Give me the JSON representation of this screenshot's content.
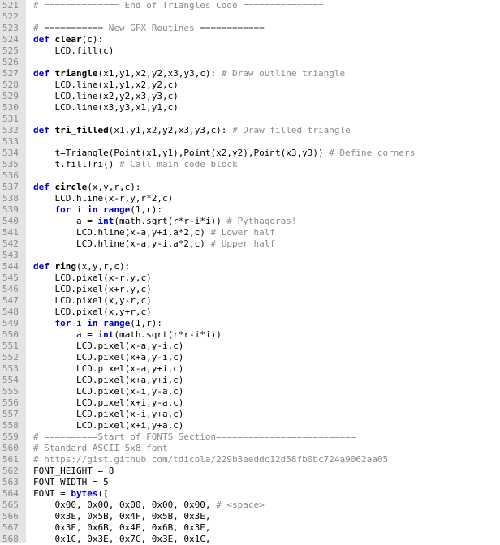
{
  "editor": {
    "lines": [
      {
        "n": "521",
        "t": [
          {
            "c": "cm",
            "s": "# ============== End of Triangles Code ==============="
          }
        ]
      },
      {
        "n": "522",
        "t": []
      },
      {
        "n": "523",
        "t": [
          {
            "c": "cm",
            "s": "# =========== New GFX Routines ============"
          }
        ]
      },
      {
        "n": "524",
        "t": [
          {
            "c": "kw",
            "s": "def "
          },
          {
            "c": "fn",
            "s": "clear"
          },
          {
            "c": "tx",
            "s": "(c):"
          }
        ]
      },
      {
        "n": "525",
        "t": [
          {
            "c": "tx",
            "s": "    LCD.fill(c)"
          }
        ]
      },
      {
        "n": "526",
        "t": []
      },
      {
        "n": "527",
        "t": [
          {
            "c": "kw",
            "s": "def "
          },
          {
            "c": "fn",
            "s": "triangle"
          },
          {
            "c": "tx",
            "s": "(x1,y1,x2,y2,x3,y3,c): "
          },
          {
            "c": "cm",
            "s": "# Draw outline triangle"
          }
        ]
      },
      {
        "n": "528",
        "t": [
          {
            "c": "tx",
            "s": "    LCD.line(x1,y1,x2,y2,c)"
          }
        ]
      },
      {
        "n": "529",
        "t": [
          {
            "c": "tx",
            "s": "    LCD.line(x2,y2,x3,y3,c)"
          }
        ]
      },
      {
        "n": "530",
        "t": [
          {
            "c": "tx",
            "s": "    LCD.line(x3,y3,x1,y1,c)"
          }
        ]
      },
      {
        "n": "531",
        "t": []
      },
      {
        "n": "532",
        "t": [
          {
            "c": "kw",
            "s": "def "
          },
          {
            "c": "fn",
            "s": "tri_filled"
          },
          {
            "c": "tx",
            "s": "(x1,y1,x2,y2,x3,y3,c): "
          },
          {
            "c": "cm",
            "s": "# Draw filled triangle"
          }
        ]
      },
      {
        "n": "533",
        "t": []
      },
      {
        "n": "534",
        "t": [
          {
            "c": "tx",
            "s": "    t=Triangle(Point(x1,y1),Point(x2,y2),Point(x3,y3)) "
          },
          {
            "c": "cm",
            "s": "# Define corners"
          }
        ]
      },
      {
        "n": "535",
        "t": [
          {
            "c": "tx",
            "s": "    t.fillTri() "
          },
          {
            "c": "cm",
            "s": "# Call main code block"
          }
        ]
      },
      {
        "n": "536",
        "t": []
      },
      {
        "n": "537",
        "t": [
          {
            "c": "kw",
            "s": "def "
          },
          {
            "c": "fn",
            "s": "circle"
          },
          {
            "c": "tx",
            "s": "(x,y,r,c):"
          }
        ]
      },
      {
        "n": "538",
        "t": [
          {
            "c": "tx",
            "s": "    LCD.hline(x-r,y,r*2,c)"
          }
        ]
      },
      {
        "n": "539",
        "t": [
          {
            "c": "tx",
            "s": "    "
          },
          {
            "c": "kw",
            "s": "for"
          },
          {
            "c": "tx",
            "s": " i "
          },
          {
            "c": "kw",
            "s": "in"
          },
          {
            "c": "tx",
            "s": " "
          },
          {
            "c": "kw",
            "s": "range"
          },
          {
            "c": "tx",
            "s": "(1,r):"
          }
        ]
      },
      {
        "n": "540",
        "t": [
          {
            "c": "tx",
            "s": "        a = "
          },
          {
            "c": "kw",
            "s": "int"
          },
          {
            "c": "tx",
            "s": "(math.sqrt(r*r-i*i)) "
          },
          {
            "c": "cm",
            "s": "# Pythagoras!"
          }
        ]
      },
      {
        "n": "541",
        "t": [
          {
            "c": "tx",
            "s": "        LCD.hline(x-a,y+i,a*2,c) "
          },
          {
            "c": "cm",
            "s": "# Lower half"
          }
        ]
      },
      {
        "n": "542",
        "t": [
          {
            "c": "tx",
            "s": "        LCD.hline(x-a,y-i,a*2,c) "
          },
          {
            "c": "cm",
            "s": "# Upper half"
          }
        ]
      },
      {
        "n": "543",
        "t": []
      },
      {
        "n": "544",
        "t": [
          {
            "c": "kw",
            "s": "def "
          },
          {
            "c": "fn",
            "s": "ring"
          },
          {
            "c": "tx",
            "s": "(x,y,r,c):"
          }
        ]
      },
      {
        "n": "545",
        "t": [
          {
            "c": "tx",
            "s": "    LCD.pixel(x-r,y,c)"
          }
        ]
      },
      {
        "n": "546",
        "t": [
          {
            "c": "tx",
            "s": "    LCD.pixel(x+r,y,c)"
          }
        ]
      },
      {
        "n": "547",
        "t": [
          {
            "c": "tx",
            "s": "    LCD.pixel(x,y-r,c)"
          }
        ]
      },
      {
        "n": "548",
        "t": [
          {
            "c": "tx",
            "s": "    LCD.pixel(x,y+r,c)"
          }
        ]
      },
      {
        "n": "549",
        "t": [
          {
            "c": "tx",
            "s": "    "
          },
          {
            "c": "kw",
            "s": "for"
          },
          {
            "c": "tx",
            "s": " i "
          },
          {
            "c": "kw",
            "s": "in"
          },
          {
            "c": "tx",
            "s": " "
          },
          {
            "c": "kw",
            "s": "range"
          },
          {
            "c": "tx",
            "s": "(1,r):"
          }
        ]
      },
      {
        "n": "550",
        "t": [
          {
            "c": "tx",
            "s": "        a = "
          },
          {
            "c": "kw",
            "s": "int"
          },
          {
            "c": "tx",
            "s": "(math.sqrt(r*r-i*i))"
          }
        ]
      },
      {
        "n": "551",
        "t": [
          {
            "c": "tx",
            "s": "        LCD.pixel(x-a,y-i,c)"
          }
        ]
      },
      {
        "n": "552",
        "t": [
          {
            "c": "tx",
            "s": "        LCD.pixel(x+a,y-i,c)"
          }
        ]
      },
      {
        "n": "553",
        "t": [
          {
            "c": "tx",
            "s": "        LCD.pixel(x-a,y+i,c)"
          }
        ]
      },
      {
        "n": "554",
        "t": [
          {
            "c": "tx",
            "s": "        LCD.pixel(x+a,y+i,c)"
          }
        ]
      },
      {
        "n": "555",
        "t": [
          {
            "c": "tx",
            "s": "        LCD.pixel(x-i,y-a,c)"
          }
        ]
      },
      {
        "n": "556",
        "t": [
          {
            "c": "tx",
            "s": "        LCD.pixel(x+i,y-a,c)"
          }
        ]
      },
      {
        "n": "557",
        "t": [
          {
            "c": "tx",
            "s": "        LCD.pixel(x-i,y+a,c)"
          }
        ]
      },
      {
        "n": "558",
        "t": [
          {
            "c": "tx",
            "s": "        LCD.pixel(x+i,y+a,c)"
          }
        ]
      },
      {
        "n": "559",
        "t": [
          {
            "c": "cm",
            "s": "# ==========Start of FONTS Section=========================="
          }
        ]
      },
      {
        "n": "560",
        "t": [
          {
            "c": "cm",
            "s": "# Standard ASCII 5x8 font"
          }
        ]
      },
      {
        "n": "561",
        "t": [
          {
            "c": "cm",
            "s": "# https://gist.github.com/tdicola/229b3eeddc12d58fb0bc724a9062aa05"
          }
        ]
      },
      {
        "n": "562",
        "t": [
          {
            "c": "tx",
            "s": "FONT_HEIGHT = 8"
          }
        ]
      },
      {
        "n": "563",
        "t": [
          {
            "c": "tx",
            "s": "FONT_WIDTH = 5"
          }
        ]
      },
      {
        "n": "564",
        "t": [
          {
            "c": "tx",
            "s": "FONT = "
          },
          {
            "c": "kw",
            "s": "bytes"
          },
          {
            "c": "tx",
            "s": "(["
          }
        ]
      },
      {
        "n": "565",
        "t": [
          {
            "c": "tx",
            "s": "    0x00, 0x00, 0x00, 0x00, 0x00, "
          },
          {
            "c": "cm",
            "s": "# <space>"
          }
        ]
      },
      {
        "n": "566",
        "t": [
          {
            "c": "tx",
            "s": "    0x3E, 0x5B, 0x4F, 0x5B, 0x3E,"
          }
        ]
      },
      {
        "n": "567",
        "t": [
          {
            "c": "tx",
            "s": "    0x3E, 0x6B, 0x4F, 0x6B, 0x3E,"
          }
        ]
      },
      {
        "n": "568",
        "t": [
          {
            "c": "tx",
            "s": "    0x1C, 0x3E, 0x7C, 0x3E, 0x1C,"
          }
        ]
      }
    ]
  }
}
